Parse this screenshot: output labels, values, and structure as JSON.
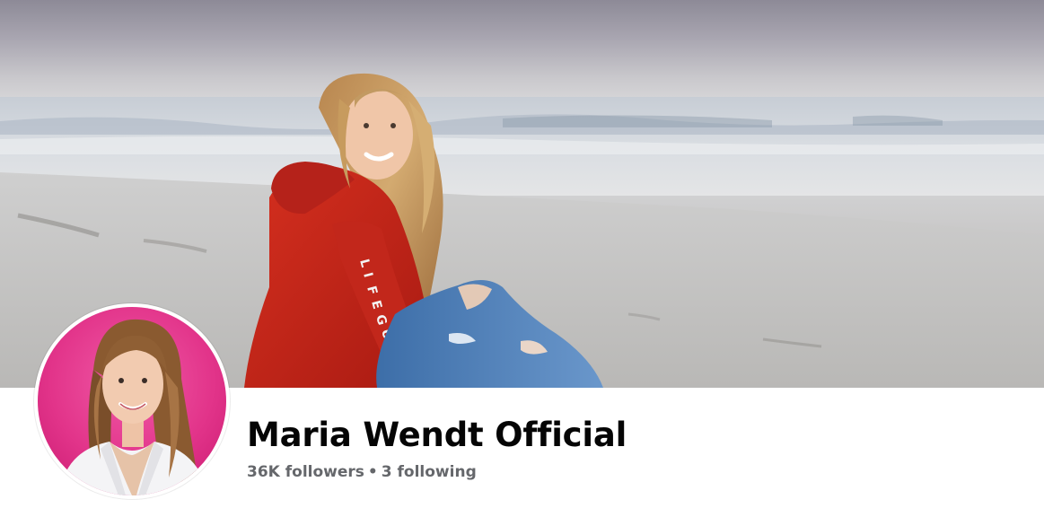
{
  "profile": {
    "name": "Maria Wendt Official",
    "followers": "36K followers",
    "separator": "•",
    "following": "3 following"
  },
  "cover": {
    "icon": "cover-photo",
    "sweatshirt_text": "LIFEGUARD"
  },
  "avatar": {
    "icon": "profile-picture"
  },
  "colors": {
    "name_text": "#050505",
    "secondary_text": "#65676b",
    "avatar_background": "#e2348a",
    "hoodie": "#c8251b",
    "jeans": "#4f7fb8"
  }
}
